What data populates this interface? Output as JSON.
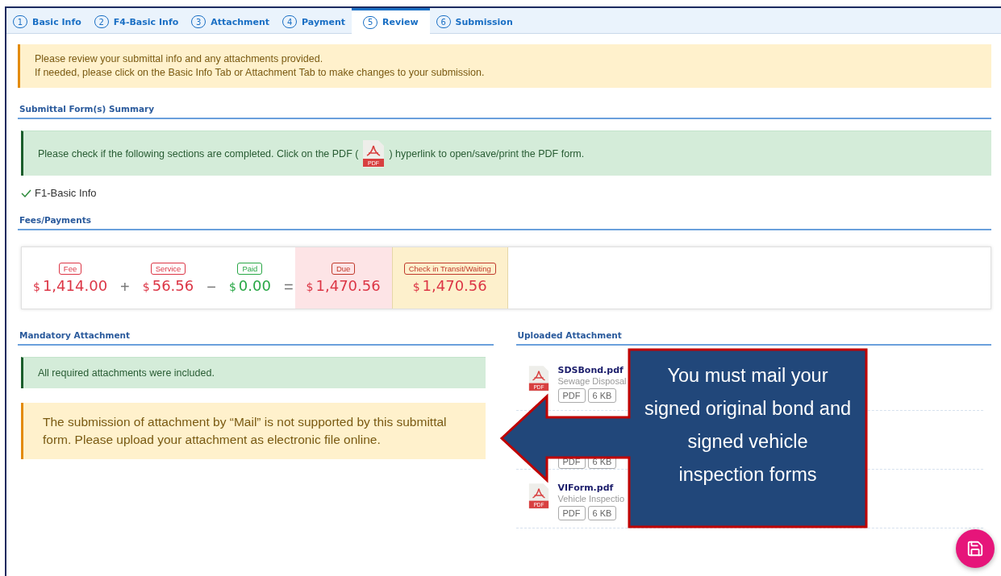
{
  "tabs": [
    {
      "number": "1",
      "label": "Basic Info",
      "selected": false
    },
    {
      "number": "2",
      "label": "F4-Basic Info",
      "selected": false
    },
    {
      "number": "3",
      "label": "Attachment",
      "selected": false
    },
    {
      "number": "4",
      "label": "Payment",
      "selected": false
    },
    {
      "number": "5",
      "label": "Review",
      "selected": true
    },
    {
      "number": "6",
      "label": "Submission",
      "selected": false
    }
  ],
  "notice": [
    "Please review your submittal info and any attachments provided.",
    "If needed, please click on the Basic Info Tab or Attachment Tab to make changes to your submission."
  ],
  "summary": {
    "title": "Submittal Form(s) Summary",
    "info_before": "Please check if the following sections are completed. Click on the PDF (",
    "pdf_label": "PDF",
    "info_after": ") hyperlink to open/save/print the PDF form.",
    "forms": [
      {
        "label": "F1-Basic Info",
        "checked": true
      }
    ]
  },
  "fees": {
    "title": "Fees/Payments",
    "items": [
      {
        "label": "Fee",
        "currency": "$",
        "amount": "1,414.00",
        "color": "#dc3545",
        "kind": "plain",
        "operator": "+"
      },
      {
        "label": "Service",
        "currency": "$",
        "amount": "56.56",
        "color": "#dc3545",
        "kind": "plain",
        "operator": "−"
      },
      {
        "label": "Paid",
        "currency": "$",
        "amount": "0.00",
        "color": "#28a745",
        "kind": "plain",
        "operator": "="
      },
      {
        "label": "Due",
        "currency": "$",
        "amount": "1,470.56",
        "color": "#dc3545",
        "kind": "due"
      },
      {
        "label": "Check in Transit/Waiting",
        "currency": "$",
        "amount": "1,470.56",
        "color": "#dc3545",
        "kind": "waiting"
      }
    ]
  },
  "mandatory": {
    "title": "Mandatory Attachment",
    "success": "All required attachments were included.",
    "warning": "The submission of attachment by “Mail” is not supported by this submittal form. Please upload your attachment as electronic file online."
  },
  "uploaded": {
    "title": "Uploaded Attachment",
    "files": [
      {
        "name": "SDSBond.pdf",
        "description": "Sewage Disposal",
        "icon_label": "PDF",
        "tags": [
          "PDF",
          "6 KB"
        ]
      },
      {
        "tags": [
          "PDF",
          "6 KB"
        ]
      },
      {
        "name": "VIForm.pdf",
        "description": "Vehicle Inspectio",
        "icon_label": "PDF",
        "tags": [
          "PDF",
          "6 KB"
        ]
      }
    ]
  },
  "callout": "You must mail your signed original bond and signed vehicle inspection forms"
}
